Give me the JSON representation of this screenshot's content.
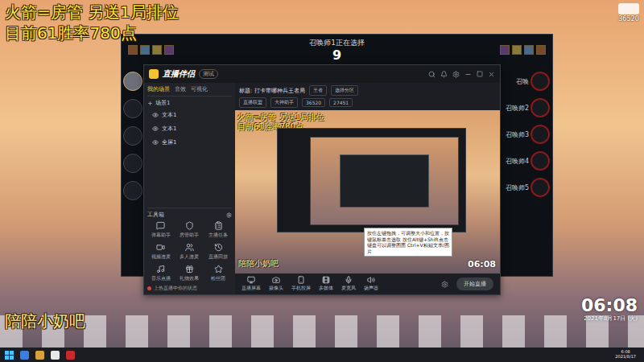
{
  "overlay": {
    "line1": "火箭=房管 另送1局排位",
    "line2": "目前61胜率780点",
    "footer": "陪陪小奶吧"
  },
  "stream_logo": {
    "id": "36520"
  },
  "clock": {
    "time": "06:08",
    "date": "2021年8月17日 (火)"
  },
  "champ_select": {
    "status": "召唤师1正在选择",
    "timer": "9",
    "ally_slots": [
      {
        "active": true
      },
      {
        "active": false
      },
      {
        "active": false
      },
      {
        "active": false
      },
      {
        "active": false
      }
    ],
    "enemy_slots": [
      {
        "name": "召唤"
      },
      {
        "name": "召唤师2"
      },
      {
        "name": "召唤师3"
      },
      {
        "name": "召唤师4"
      },
      {
        "name": "召唤师5"
      }
    ]
  },
  "companion": {
    "title": "直播伴侣",
    "badge": "测试",
    "scene_tabs": [
      {
        "label": "我的场景",
        "selected": true
      },
      {
        "label": "音效",
        "selected": false
      },
      {
        "label": "可视化",
        "selected": false
      }
    ],
    "scene_name": "场景1",
    "sources": [
      {
        "label": "文本1",
        "visible": true
      },
      {
        "label": "文本1",
        "visible": true
      },
      {
        "label": "全屏1",
        "visible": true
      }
    ],
    "toolbox_title": "工具箱",
    "tools": [
      "弹幕助手",
      "房管助手",
      "主播任务",
      "视频连麦",
      "多人连麦",
      "直播回放",
      "音乐点播",
      "礼物效果",
      "粉丝团"
    ],
    "notice": "上热直播中你的状态",
    "stream_title": "标题: 打卡带哪种兵王者局",
    "category": "王者",
    "area": "选择分区",
    "meta": [
      "直播联盟",
      "大神助手",
      "36520",
      "27451"
    ],
    "preview": {
      "line1": "火箭=房管 另送1局排位",
      "line2": "目前61胜率780点",
      "footer": "陪陪小奶吧",
      "time": "06:08",
      "tooltip": "按住左键拖拽，可调整大小和位置，按键鼠标单击选取 按住Alt键+Shift点击键盘可以调整图面 Ctrl+V粘贴文本/图片"
    },
    "bottom_tools": [
      "直播屏幕",
      "摄像头",
      "手机投屏",
      "多媒体",
      "麦克风",
      "扬声器"
    ],
    "start_button": "开始直播"
  },
  "taskbar": {
    "time": "6:08",
    "date": "2021/8/17"
  }
}
